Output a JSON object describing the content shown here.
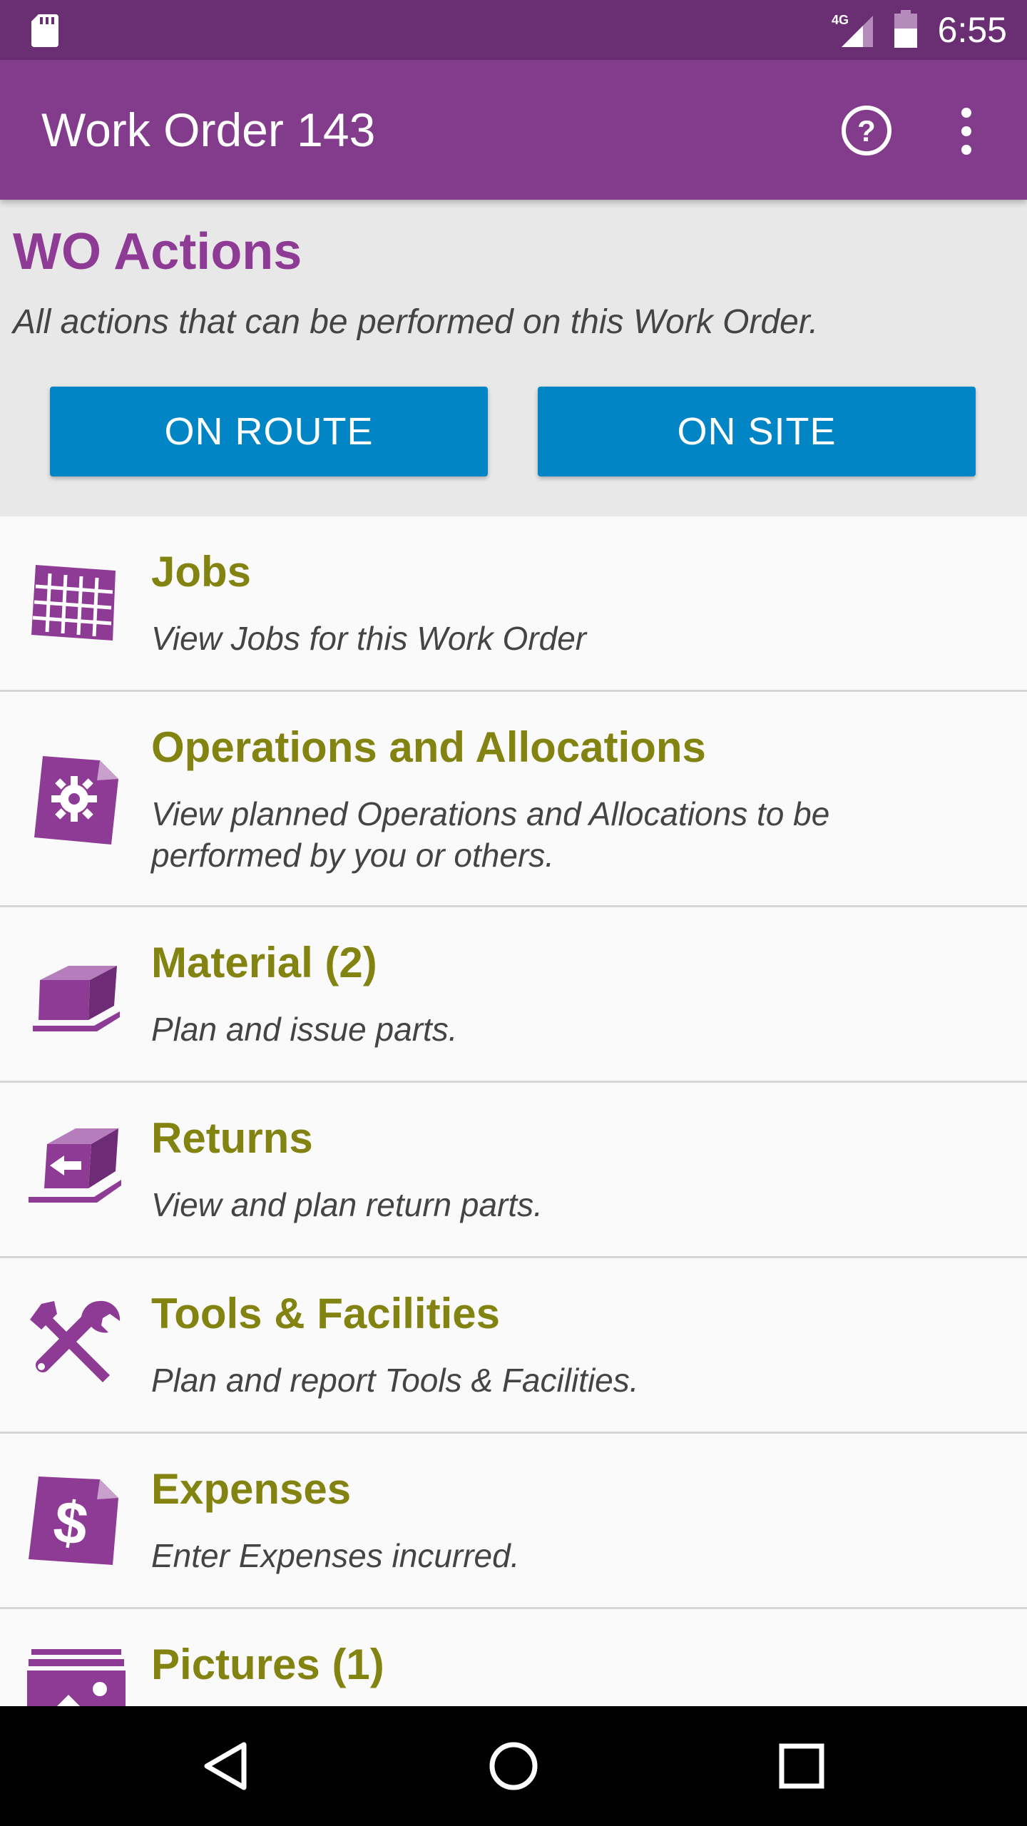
{
  "status_bar": {
    "network": "4G",
    "time": "6:55"
  },
  "app_bar": {
    "title": "Work Order 143",
    "help_icon": "help-circle-icon",
    "more_icon": "more-vert-icon"
  },
  "actions": {
    "heading": "WO Actions",
    "subtitle": "All actions that can be performed on this Work Order.",
    "buttons": [
      {
        "label": "ON ROUTE"
      },
      {
        "label": "ON SITE"
      }
    ],
    "button_color": "#0285c4"
  },
  "menu_items": [
    {
      "icon": "grid-icon",
      "title": "Jobs",
      "description": "View Jobs for this Work Order"
    },
    {
      "icon": "document-gear-icon",
      "title": "Operations and Allocations",
      "description": "View planned Operations and Allocations to be performed by you or others."
    },
    {
      "icon": "box-icon",
      "title": "Material (2)",
      "description": "Plan and issue parts."
    },
    {
      "icon": "box-return-icon",
      "title": "Returns",
      "description": "View and plan return parts."
    },
    {
      "icon": "tools-icon",
      "title": "Tools & Facilities",
      "description": "Plan and report Tools & Facilities."
    },
    {
      "icon": "dollar-document-icon",
      "title": "Expenses",
      "description": "Enter Expenses incurred."
    },
    {
      "icon": "pictures-icon",
      "title": "Pictures (1)",
      "description": ""
    }
  ],
  "nav_bar": {
    "back": "back-triangle-icon",
    "home": "home-circle-icon",
    "recents": "recents-square-icon"
  },
  "colors": {
    "status_bar": "#6a2f72",
    "app_bar": "#833c8b",
    "heading": "#8e3b95",
    "item_title": "#838312",
    "icon": "#8e3b95"
  }
}
